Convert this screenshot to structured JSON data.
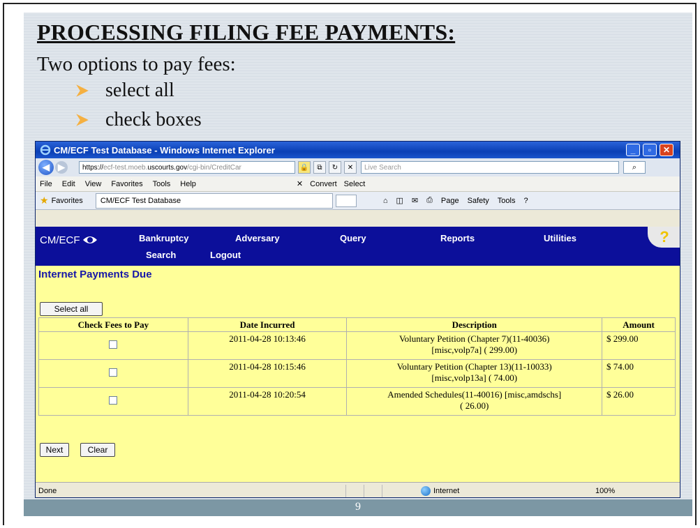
{
  "slide": {
    "title": "PROCESSING FILING FEE PAYMENTS:",
    "intro": "Two options to pay fees:",
    "bullets": [
      "select all",
      "check boxes"
    ],
    "page_number": "9"
  },
  "browser": {
    "title": "CM/ECF Test Database - Windows Internet Explorer",
    "address": {
      "prefix": "https://",
      "host_grey": "ecf-test.moeb.",
      "host": "uscourts.gov",
      "path": "/cgi-bin/CreditCar"
    },
    "search_placeholder": "Live Search",
    "menu": [
      "File",
      "Edit",
      "View",
      "Favorites",
      "Tools",
      "Help"
    ],
    "menu_tools": [
      "Convert",
      "Select"
    ],
    "favorites_label": "Favorites",
    "tab_label": "CM/ECF Test Database",
    "command_bar": [
      "Page",
      "Safety",
      "Tools"
    ],
    "status": {
      "text": "Done",
      "zone": "Internet",
      "zoom": "100%"
    }
  },
  "app": {
    "logo": "CM/ECF",
    "nav_row1": [
      "Bankruptcy",
      "Adversary",
      "Query",
      "Reports",
      "Utilities"
    ],
    "nav_row2": [
      "Search",
      "Logout"
    ],
    "heading": "Internet Payments Due",
    "select_all_label": "Select all",
    "table": {
      "headers": [
        "Check Fees to Pay",
        "Date Incurred",
        "Description",
        "Amount"
      ],
      "rows": [
        {
          "date": "2011-04-28 10:13:46",
          "desc1": "Voluntary Petition (Chapter 7)(11-40036)",
          "desc2": "[misc,volp7a] ( 299.00)",
          "amount": "$ 299.00"
        },
        {
          "date": "2011-04-28 10:15:46",
          "desc1": "Voluntary Petition (Chapter 13)(11-10033)",
          "desc2": "[misc,volp13a] ( 74.00)",
          "amount": "$ 74.00"
        },
        {
          "date": "2011-04-28 10:20:54",
          "desc1": "Amended Schedules(11-40016) [misc,amdschs]",
          "desc2": "( 26.00)",
          "amount": "$ 26.00"
        }
      ]
    },
    "next_label": "Next",
    "clear_label": "Clear"
  },
  "colors": {
    "page_bg": "#ffff99",
    "nav_bg": "#0c0f9a",
    "heading": "#1616a8",
    "bullet_arrow": "#f5b041"
  }
}
